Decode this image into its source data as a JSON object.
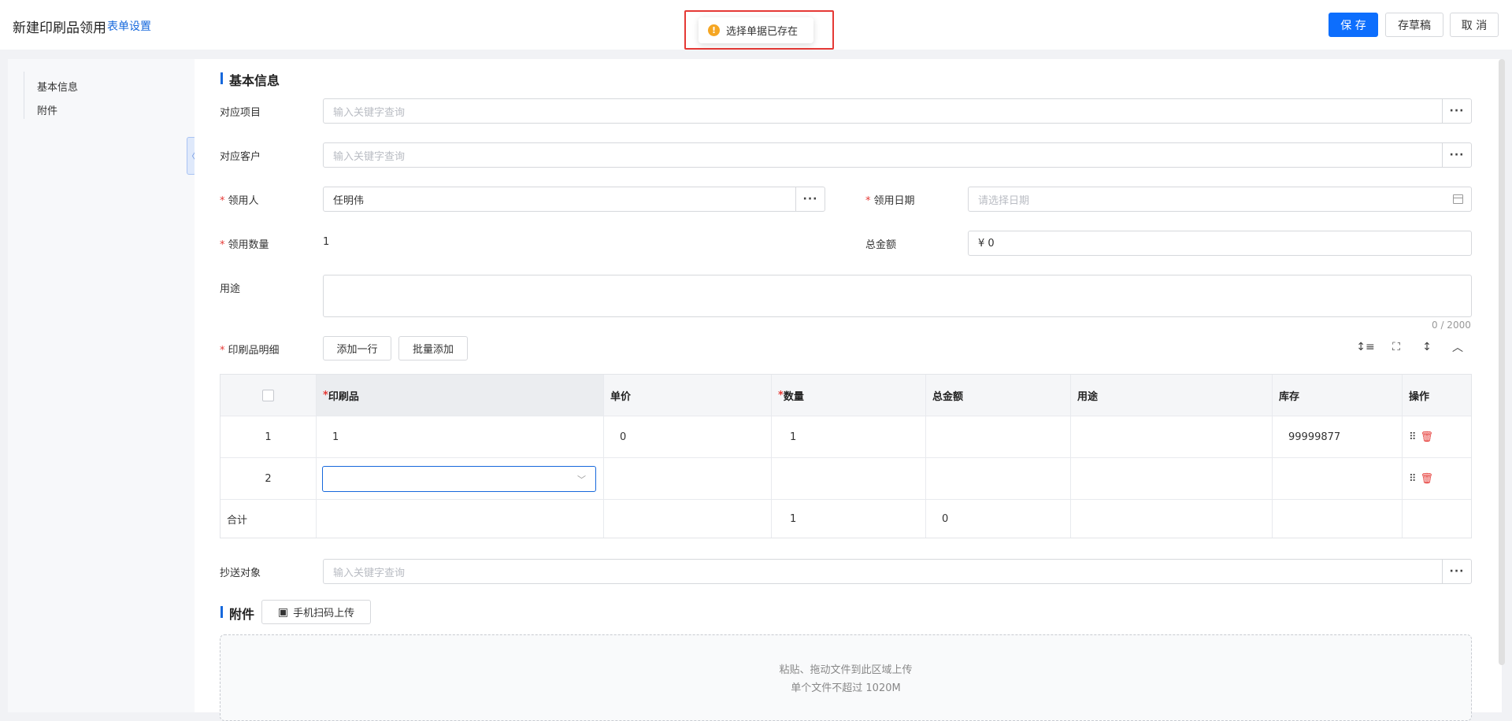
{
  "header": {
    "title": "新建印刷品领用",
    "form_settings": "表单设置",
    "save": "保 存",
    "draft": "存草稿",
    "cancel": "取 消"
  },
  "toast": {
    "icon": "warning-icon",
    "message": "选择单据已存在"
  },
  "leftnav": {
    "items": [
      "基本信息",
      "附件"
    ]
  },
  "basic": {
    "section_title": "基本信息",
    "project": {
      "label": "对应项目",
      "placeholder": "输入关键字查询"
    },
    "customer": {
      "label": "对应客户",
      "placeholder": "输入关键字查询"
    },
    "recipient": {
      "label": "领用人",
      "value": "任明伟"
    },
    "date": {
      "label": "领用日期",
      "placeholder": "请选择日期"
    },
    "quantity": {
      "label": "领用数量",
      "value": "1"
    },
    "total": {
      "label": "总金额",
      "value": "¥ 0"
    },
    "purpose": {
      "label": "用途",
      "counter": "0 / 2000"
    },
    "details": {
      "label": "印刷品明细",
      "add_row": "添加一行",
      "batch_add": "批量添加"
    },
    "cc": {
      "label": "抄送对象",
      "placeholder": "输入关键字查询"
    }
  },
  "table": {
    "columns": [
      "印刷品",
      "单价",
      "数量",
      "总金额",
      "用途",
      "库存",
      "操作"
    ],
    "rows": [
      {
        "no": "1",
        "item": "1",
        "price": "0",
        "qty": "1",
        "total": "",
        "purpose": "",
        "stock": "99999877"
      },
      {
        "no": "2",
        "item": "",
        "price": "",
        "qty": "",
        "total": "",
        "purpose": "",
        "stock": ""
      }
    ],
    "summary": {
      "label": "合计",
      "qty": "1",
      "total": "0"
    }
  },
  "attachment": {
    "section_title": "附件",
    "scan_upload": "手机扫码上传",
    "drop_text1": "粘贴、拖动文件到此区域上传",
    "drop_text2": "单个文件不超过 1020M"
  },
  "colors": {
    "primary": "#0d6efd",
    "required": "#e53935",
    "warning": "#f5a623"
  }
}
